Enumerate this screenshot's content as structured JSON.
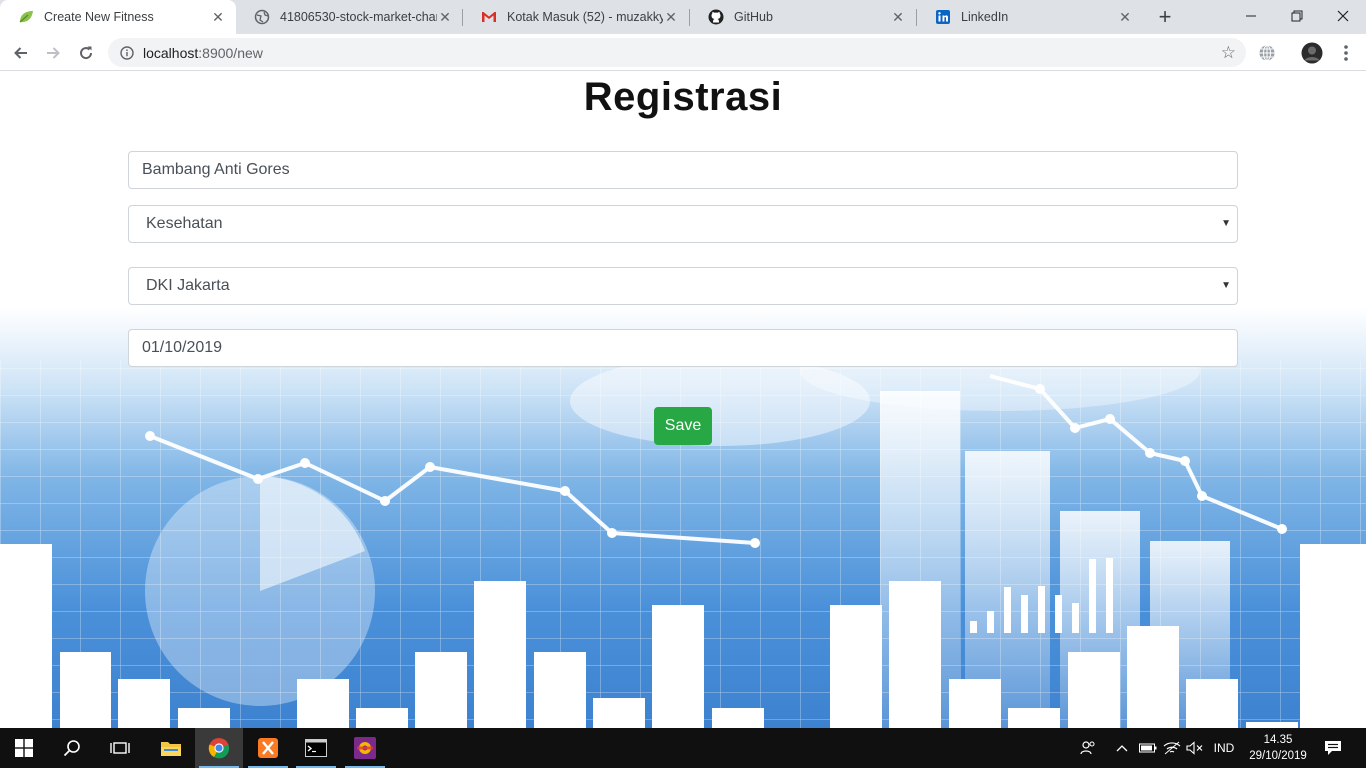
{
  "browser": {
    "tabs": [
      {
        "label": "Create New Fitness",
        "icon": "leaf-icon",
        "active": true
      },
      {
        "label": "41806530-stock-market-chart-",
        "icon": "globe-icon",
        "active": false
      },
      {
        "label": "Kotak Masuk (52) - muzakky1s",
        "icon": "gmail-icon",
        "active": false
      },
      {
        "label": "GitHub",
        "icon": "github-icon",
        "active": false
      },
      {
        "label": "LinkedIn",
        "icon": "linkedin-icon",
        "active": false
      }
    ],
    "url_host": "localhost",
    "url_path": ":8900/new"
  },
  "form": {
    "title": "Registrasi",
    "name_value": "Bambang Anti Gores",
    "category_value": "Kesehatan",
    "province_value": "DKI Jakarta",
    "date_value": "01/10/2019",
    "save_label": "Save"
  },
  "taskbar": {
    "language": "IND",
    "time": "14.35",
    "date": "29/10/2019"
  },
  "colors": {
    "save_button": "#28a745",
    "chart_background": "#4a90d9"
  }
}
